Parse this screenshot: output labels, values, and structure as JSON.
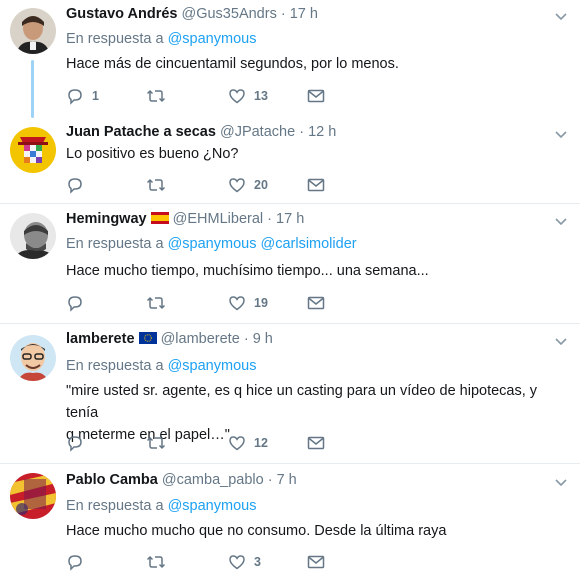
{
  "reply_prefix": "En respuesta a",
  "tweets": [
    {
      "name": "Gustavo Andrés",
      "handle": "@Gus35Andrs",
      "time": "17 h",
      "reply_to": [
        "@spanymous"
      ],
      "text": "Hace más de cincuentamil segundos, por lo menos.",
      "replies": "1",
      "retweets": "",
      "likes": "13"
    },
    {
      "name": "Juan Patache a secas",
      "handle": "@JPatache",
      "time": "12 h",
      "reply_to": [],
      "text": "Lo positivo es bueno ¿No?",
      "replies": "",
      "retweets": "",
      "likes": "20"
    },
    {
      "name": "Hemingway",
      "flag": "spain-flag-icon",
      "handle": "@EHMLiberal",
      "time": "17 h",
      "reply_to": [
        "@spanymous",
        "@carlsimolider"
      ],
      "text": "Hace mucho tiempo, muchísimo tiempo... una semana...",
      "replies": "",
      "retweets": "",
      "likes": "19"
    },
    {
      "name": "lamberete",
      "flag": "eu-flag-icon",
      "handle": "@lamberete",
      "time": "9 h",
      "reply_to": [
        "@spanymous"
      ],
      "text_line1": "\"mire usted sr. agente, es q hice un casting para un vídeo de hipotecas, y tenía",
      "text_line2": "q meterme en el papel…\"",
      "replies": "",
      "retweets": "",
      "likes": "12"
    },
    {
      "name": "Pablo Camba",
      "handle": "@camba_pablo",
      "time": "7 h",
      "reply_to": [
        "@spanymous"
      ],
      "text": "Hace mucho mucho que no consumo. Desde la última raya",
      "replies": "",
      "retweets": "",
      "likes": "3"
    }
  ],
  "colors": {
    "link": "#1da1f2",
    "secondary": "#657786",
    "divider": "#e6ecf0",
    "thread_line": "#9fd3f5"
  }
}
